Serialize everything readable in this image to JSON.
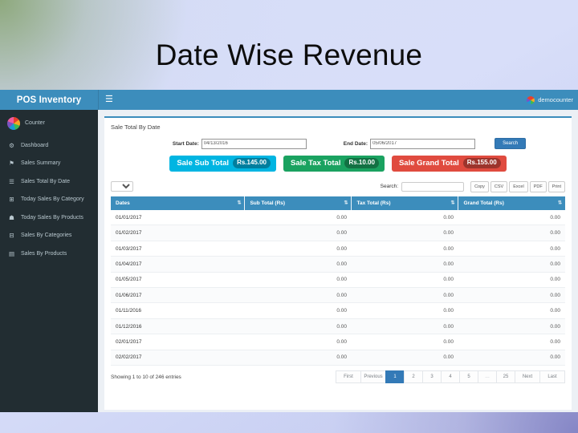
{
  "slide": {
    "title": "Date Wise Revenue"
  },
  "navbar": {
    "brand": "POS Inventory",
    "menu_icon": "hamburger-icon",
    "user": "democounter"
  },
  "sidebar": {
    "user_label": "Counter",
    "items": [
      {
        "label": "Dashboard",
        "icon": "⚙"
      },
      {
        "label": "Sales Summary",
        "icon": "⚑"
      },
      {
        "label": "Sales Total By Date",
        "icon": "☰"
      },
      {
        "label": "Today Sales By Category",
        "icon": "⊞"
      },
      {
        "label": "Today Sales By Products",
        "icon": "☗"
      },
      {
        "label": "Sales By Categories",
        "icon": "⊟"
      },
      {
        "label": "Sales By Products",
        "icon": "▤"
      }
    ]
  },
  "panel": {
    "title": "Sale Total By Date",
    "form": {
      "start_label": "Start Date:",
      "start_value": "04/13/2016",
      "end_label": "End Date:",
      "end_value": "05/06/2017",
      "search_button": "Search"
    },
    "badges": [
      {
        "label": "Sale Sub Total",
        "value": "Rs.145.00",
        "color": "#00b5e2"
      },
      {
        "label": "Sale Tax Total",
        "value": "Rs.10.00",
        "color": "#1aa260"
      },
      {
        "label": "Sale Grand Total",
        "value": "Rs.155.00",
        "color": "#e04b3f"
      }
    ],
    "toolbar": {
      "page_length": "10",
      "search_label": "Search:",
      "search_value": "",
      "export_buttons": [
        "Copy",
        "CSV",
        "Excel",
        "PDF",
        "Print"
      ]
    },
    "table": {
      "columns": [
        "Dates",
        "Sub Total (Rs)",
        "Tax Total (Rs)",
        "Grand Total (Rs)"
      ],
      "rows": [
        [
          "01/01/2017",
          "0.00",
          "0.00",
          "0.00"
        ],
        [
          "01/02/2017",
          "0.00",
          "0.00",
          "0.00"
        ],
        [
          "01/03/2017",
          "0.00",
          "0.00",
          "0.00"
        ],
        [
          "01/04/2017",
          "0.00",
          "0.00",
          "0.00"
        ],
        [
          "01/05/2017",
          "0.00",
          "0.00",
          "0.00"
        ],
        [
          "01/06/2017",
          "0.00",
          "0.00",
          "0.00"
        ],
        [
          "01/11/2016",
          "0.00",
          "0.00",
          "0.00"
        ],
        [
          "01/12/2016",
          "0.00",
          "0.00",
          "0.00"
        ],
        [
          "02/01/2017",
          "0.00",
          "0.00",
          "0.00"
        ],
        [
          "02/02/2017",
          "0.00",
          "0.00",
          "0.00"
        ]
      ]
    },
    "footer": {
      "info": "Showing 1 to 10 of 246 entries",
      "pages": [
        "First",
        "Previous",
        "1",
        "2",
        "3",
        "4",
        "5",
        "…",
        "25",
        "Next",
        "Last"
      ],
      "active_page": "1"
    }
  }
}
